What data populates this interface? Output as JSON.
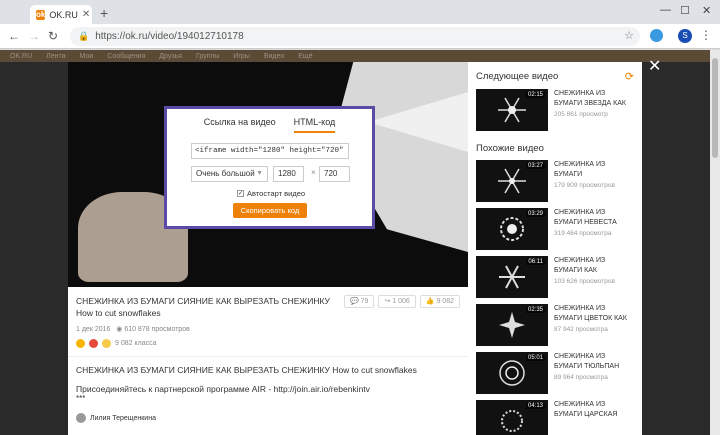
{
  "browser": {
    "tab_title": "OK.RU",
    "tab_icon": "ok-logo-icon",
    "url": "https://ok.ru/video/194012710178",
    "profile_initial": "S"
  },
  "oknav": {
    "items": [
      "OK.RU",
      "Лента",
      "Мои",
      "Сообщения",
      "Друзья",
      "Группы",
      "Игры",
      "Видео",
      "Ещё"
    ]
  },
  "embed_dialog": {
    "tab_link": "Ссылка на видео",
    "tab_html": "HTML-код",
    "code": "<iframe width=\"1280\" height=\"720\" src=\"//o",
    "size_option": "Очень большой",
    "width": "1280",
    "height": "720",
    "times": "×",
    "autostart_label": "Автостарт видео",
    "copy_button": "Скопировать код"
  },
  "video": {
    "title": "СНЕЖИНКА ИЗ БУМАГИ СИЯНИЕ КАК ВЫРЕЗАТЬ СНЕЖИНКУ How to cut snowflakes",
    "date": "1 дек 2016",
    "views": "610 878 просмотров",
    "classes": "9 082 класса",
    "comments_count": "79",
    "shares_count": "1 006",
    "likes_count": "9 082",
    "description": "СНЕЖИНКА ИЗ БУМАГИ СИЯНИЕ КАК ВЫРЕЗАТЬ СНЕЖИНКУ How to cut snowflakes",
    "partner_text": "Присоединяйтесь к партнерской программе AIR - http://join.air.io/rebenkintv",
    "stars": "***",
    "comment_author": "Лилия Терещенкина"
  },
  "sidebar": {
    "next_heading": "Следующее видео",
    "similar_heading": "Похожие видео",
    "next": {
      "title": "СНЕЖИНКА ИЗ БУМАГИ ЗВЕЗДА КАК",
      "views": "205 861 просмотр",
      "duration": "02:15"
    },
    "similar": [
      {
        "title": "СНЕЖИНКА ИЗ БУМАГИ",
        "views": "179 909 просмотров",
        "duration": "03:27"
      },
      {
        "title": "СНЕЖИНКА ИЗ БУМАГИ НЕВЕСТА",
        "views": "319 464 просмотра",
        "duration": "03:29"
      },
      {
        "title": "СНЕЖИНКА ИЗ БУМАГИ КАК",
        "views": "103 626 просмотров",
        "duration": "06:11"
      },
      {
        "title": "СНЕЖИНКА ИЗ БУМАГИ ЦВЕТОК КАК",
        "views": "87 942 просмотра",
        "duration": "02:35"
      },
      {
        "title": "СНЕЖИНКА ИЗ БУМАГИ ТЮЛЬПАН",
        "views": "89 964 просмотра",
        "duration": "05:01"
      },
      {
        "title": "СНЕЖИНКА ИЗ БУМАГИ ЦАРСКАЯ",
        "views": "",
        "duration": "04:13"
      }
    ]
  },
  "colors": {
    "accent": "#ee8208",
    "dialog_border": "#5b4aa6"
  }
}
